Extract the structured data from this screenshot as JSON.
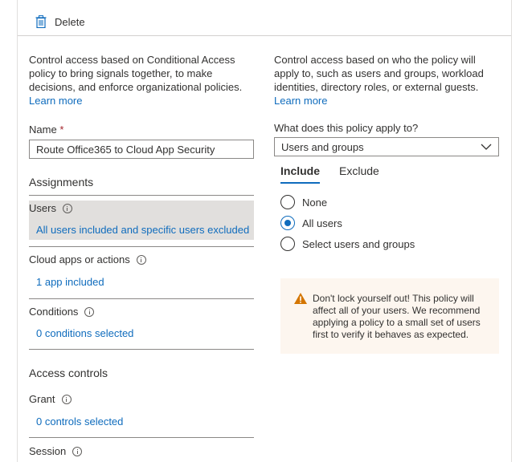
{
  "toolbar": {
    "delete_label": "Delete",
    "delete_icon": "trash-icon"
  },
  "left": {
    "description": "Control access based on Conditional Access policy to bring signals together, to make decisions, and enforce organizational policies.",
    "learn_more": "Learn more",
    "name_label": "Name",
    "required_mark": "*",
    "name_value": "Route Office365 to Cloud App Security",
    "assignments_heading": "Assignments",
    "users": {
      "label": "Users",
      "value": "All users included and specific users excluded"
    },
    "cloud_apps": {
      "label": "Cloud apps or actions",
      "value": "1 app included"
    },
    "conditions": {
      "label": "Conditions",
      "value": "0 conditions selected"
    },
    "access_controls_heading": "Access controls",
    "grant": {
      "label": "Grant",
      "value": "0 controls selected"
    },
    "session": {
      "label": "Session"
    }
  },
  "right": {
    "description": "Control access based on who the policy will apply to, such as users and groups, workload identities, directory roles, or external guests.",
    "learn_more": "Learn more",
    "apply_label": "What does this policy apply to?",
    "apply_value": "Users and groups",
    "tabs": [
      {
        "label": "Include"
      },
      {
        "label": "Exclude"
      }
    ],
    "options": [
      {
        "label": "None",
        "selected": false
      },
      {
        "label": "All users",
        "selected": true
      },
      {
        "label": "Select users and groups",
        "selected": false
      }
    ],
    "warning": "Don't lock yourself out! This policy will affect all of your users. We recommend applying a policy to a small set of users first to verify it behaves as expected."
  },
  "colors": {
    "link": "#0f6cbd",
    "warning_bg": "#fdf6ef",
    "warning_icon": "#d47500",
    "selected_bg": "#e1dfdd"
  }
}
